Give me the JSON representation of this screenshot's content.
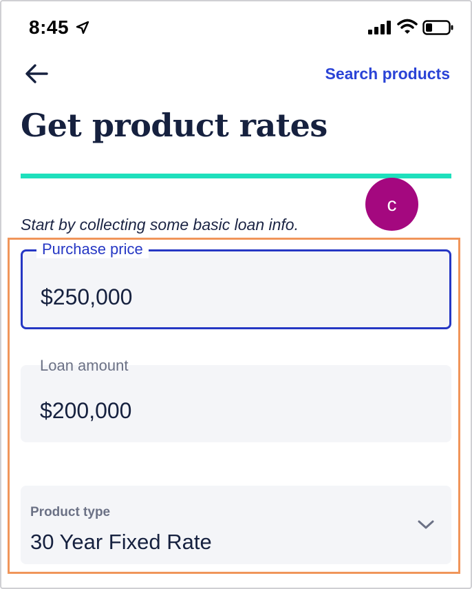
{
  "status_bar": {
    "time": "8:45"
  },
  "nav": {
    "search_label": "Search products"
  },
  "page": {
    "title": "Get product rates",
    "step_badge": "c",
    "intro": "Start by collecting some basic loan info."
  },
  "fields": {
    "purchase_price": {
      "label": "Purchase price",
      "value": "$250,000"
    },
    "loan_amount": {
      "label": "Loan amount",
      "value": "$200,000"
    },
    "product_type": {
      "label": "Product type",
      "value": "30 Year Fixed Rate"
    }
  },
  "colors": {
    "accent": "#2a43d6",
    "progress": "#1ee0bc",
    "badge": "#a4087f",
    "highlight": "#f0955a",
    "title": "#16213f"
  },
  "icons": [
    "location-arrow-icon",
    "signal-icon",
    "wifi-icon",
    "battery-icon",
    "back-arrow-icon",
    "chevron-down-icon"
  ]
}
